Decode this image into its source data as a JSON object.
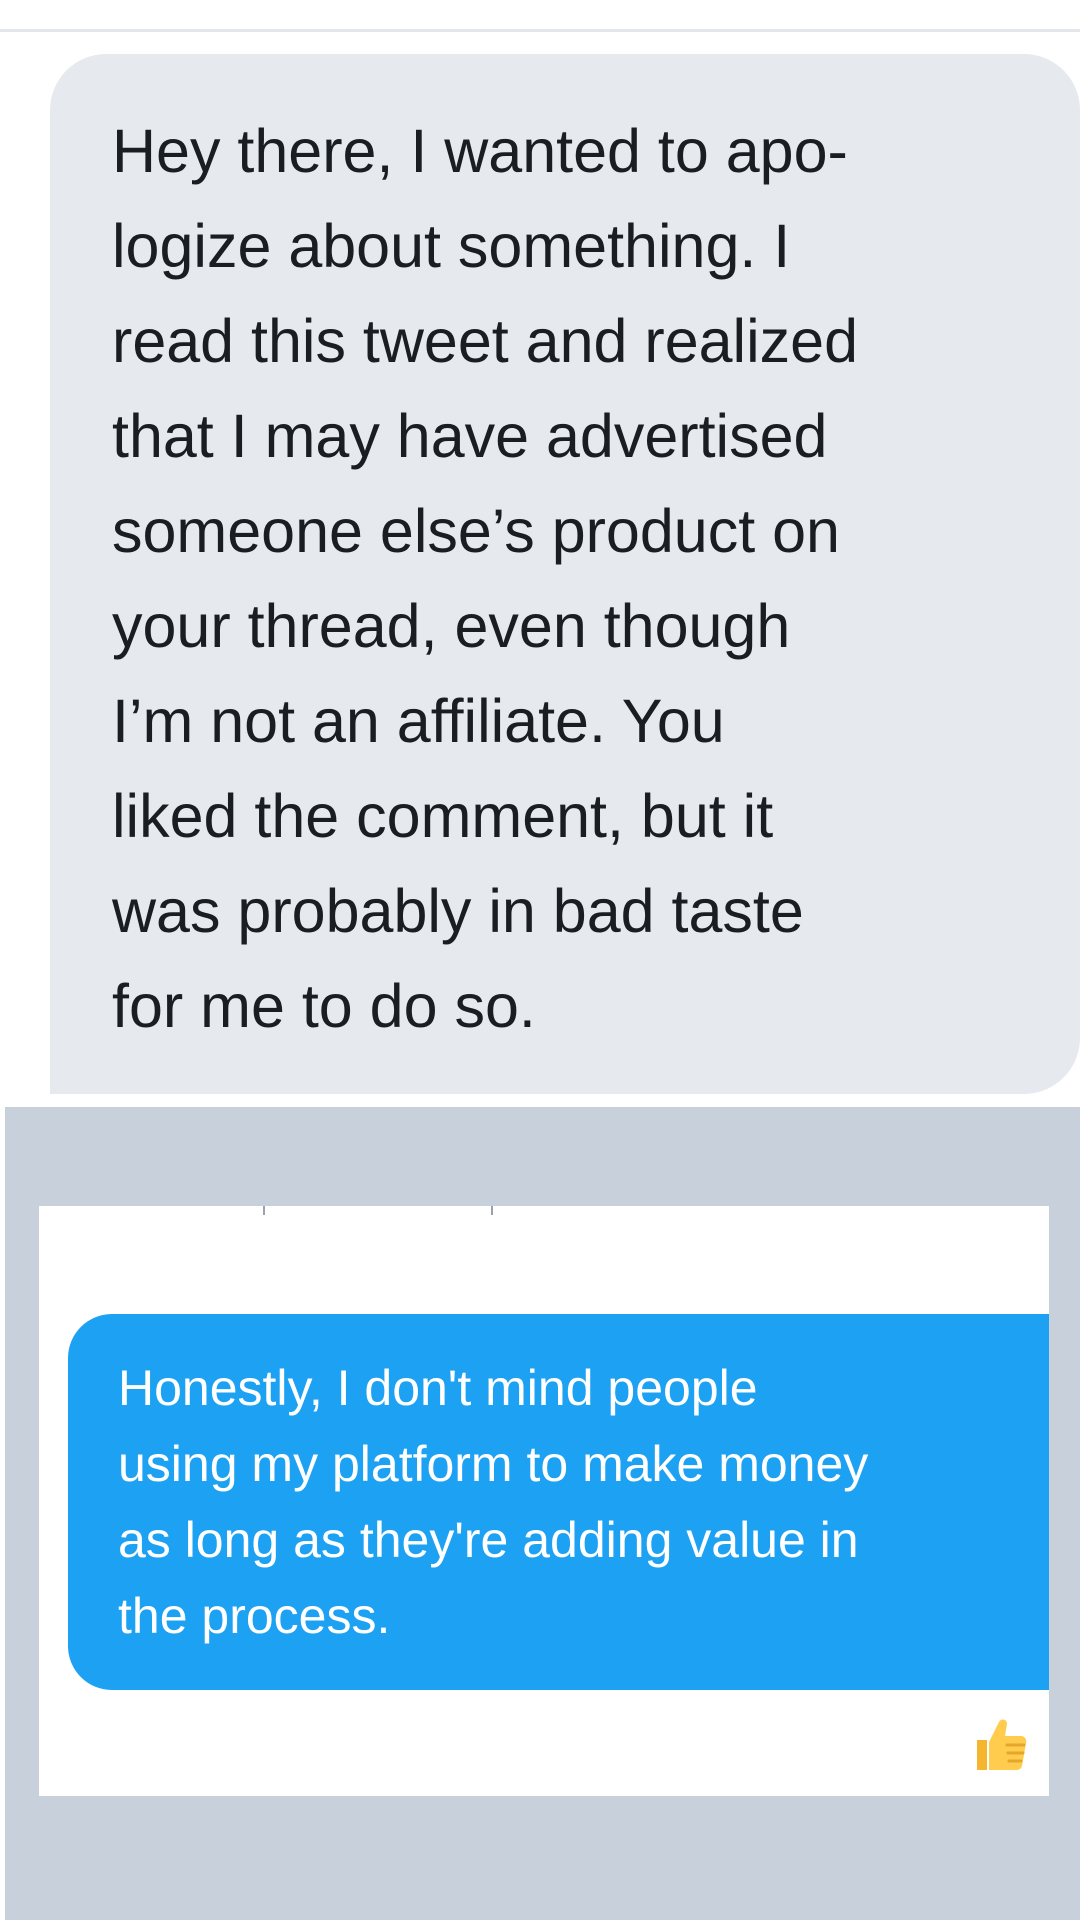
{
  "conversation": {
    "received_message": {
      "text": "Hey there, I wanted to apo-\nlogize about something.  I\nread this tweet and realized\nthat I may have advertised\nsomeone else’s product on\nyour thread, even though\nI’m not an affiliate.  You\nliked the comment, but it\nwas probably in bad taste\nfor me to do so."
    },
    "sent_message": {
      "text": "Honestly, I don't mind people\nusing my platform to make money\nas long as they're adding value in\nthe process."
    },
    "reaction": {
      "icon": "thumbs-up-icon"
    }
  },
  "colors": {
    "received_bubble": "#e6e9ee",
    "sent_bubble": "#1da1f2",
    "panel_background": "#c8d0dc",
    "reaction_yellow": "#f7c33c"
  }
}
